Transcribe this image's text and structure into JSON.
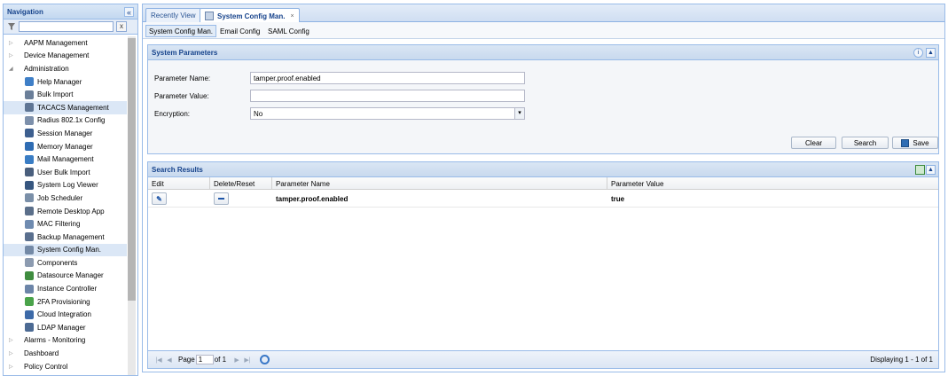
{
  "navigation": {
    "title": "Navigation",
    "collapse_icon": "«",
    "filter_placeholder": "",
    "clear_icon": "x",
    "items_before": [
      {
        "label": "AAPM Management",
        "expanded": false
      },
      {
        "label": "Device Management",
        "expanded": false
      },
      {
        "label": "Administration",
        "expanded": true
      }
    ],
    "admin_children": [
      {
        "label": "Help Manager",
        "icon": "help-icon",
        "color": "#3f7fc7"
      },
      {
        "label": "Bulk Import",
        "icon": "import-icon",
        "color": "#6b7f99"
      },
      {
        "label": "TACACS Management",
        "icon": "tacacs-icon",
        "color": "#5f7594",
        "selected": true
      },
      {
        "label": "Radius 802.1x Config",
        "icon": "radius-icon",
        "color": "#7d90ab"
      },
      {
        "label": "Session Manager",
        "icon": "session-icon",
        "color": "#3d5f8f"
      },
      {
        "label": "Memory Manager",
        "icon": "memory-icon",
        "color": "#2f6cb3"
      },
      {
        "label": "Mail Management",
        "icon": "mail-icon",
        "color": "#3a7dc4"
      },
      {
        "label": "User Bulk Import",
        "icon": "user-import-icon",
        "color": "#4a5f7d"
      },
      {
        "label": "System Log Viewer",
        "icon": "log-icon",
        "color": "#36567f"
      },
      {
        "label": "Job Scheduler",
        "icon": "scheduler-icon",
        "color": "#7a8fa8"
      },
      {
        "label": "Remote Desktop App",
        "icon": "remote-desktop-icon",
        "color": "#5b6f8a"
      },
      {
        "label": "MAC Filtering",
        "icon": "mac-filter-icon",
        "color": "#6f8bb0"
      },
      {
        "label": "Backup Management",
        "icon": "backup-icon",
        "color": "#5a6f8e"
      },
      {
        "label": "System Config Man.",
        "icon": "system-config-icon",
        "color": "#7389a6",
        "selected": true
      },
      {
        "label": "Components",
        "icon": "components-icon",
        "color": "#8c9bb0"
      },
      {
        "label": "Datasource Manager",
        "icon": "datasource-icon",
        "color": "#3f8c3f"
      },
      {
        "label": "Instance Controller",
        "icon": "instance-icon",
        "color": "#6c85a8"
      },
      {
        "label": "2FA Provisioning",
        "icon": "2fa-icon",
        "color": "#4aa34a"
      },
      {
        "label": "Cloud Integration",
        "icon": "cloud-icon",
        "color": "#3d6aa8"
      },
      {
        "label": "LDAP Manager",
        "icon": "ldap-icon",
        "color": "#4c6a93"
      }
    ],
    "items_after": [
      {
        "label": "Alarms - Monitoring",
        "expanded": false
      },
      {
        "label": "Dashboard",
        "expanded": false
      },
      {
        "label": "Policy Control",
        "expanded": false
      }
    ]
  },
  "tabs": [
    {
      "label": "Recently View"
    },
    {
      "label": "System Config Man.",
      "active": true,
      "close": "×"
    }
  ],
  "subtabs": [
    {
      "label": "System Config Man.",
      "active": true
    },
    {
      "label": "Email Config"
    },
    {
      "label": "SAML Config"
    }
  ],
  "system_parameters": {
    "title": "System Parameters",
    "info_icon": "i",
    "collapse_icon": "▲",
    "parameter_name_label": "Parameter Name:",
    "parameter_name_value": "tamper.proof.enabled",
    "parameter_value_label": "Parameter Value:",
    "parameter_value_value": "",
    "encryption_label": "Encryption:",
    "encryption_value": "No",
    "dropdown_icon": "▾",
    "clear_label": "Clear",
    "search_label": "Search",
    "save_label": "Save"
  },
  "search_results": {
    "title": "Search Results",
    "collapse_icon": "▲",
    "columns": [
      "Edit",
      "Delete/Reset",
      "Parameter Name",
      "Parameter Value"
    ],
    "rows": [
      {
        "edit_icon": "✎",
        "parameter_name": "tamper.proof.enabled",
        "parameter_value": "true"
      }
    ]
  },
  "pager": {
    "first": "|◀",
    "prev": "◀",
    "page_label": "Page",
    "page_value": "1",
    "of_label": "of 1",
    "next": "▶",
    "last": "▶|",
    "display_text": "Displaying 1 - 1 of 1"
  }
}
